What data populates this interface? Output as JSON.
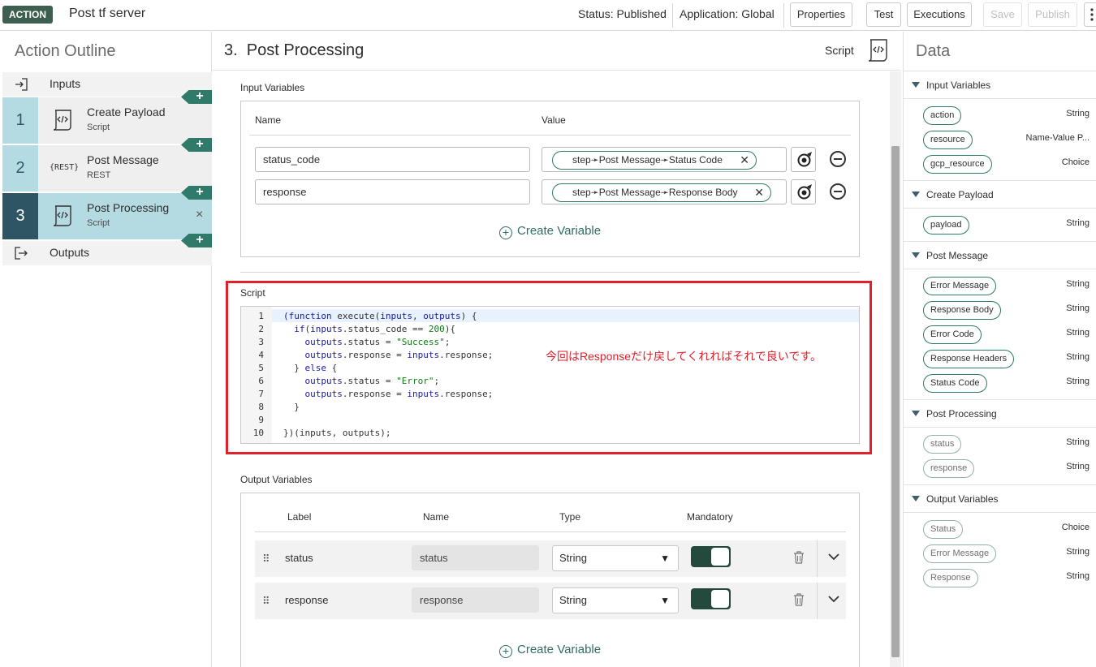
{
  "header": {
    "badge": "ACTION",
    "title": "Post tf server",
    "status": "Status: Published",
    "application": "Application: Global",
    "buttons": {
      "properties": "Properties",
      "test": "Test",
      "executions": "Executions",
      "save": "Save",
      "publish": "Publish"
    }
  },
  "outline": {
    "title": "Action Outline",
    "inputs_label": "Inputs",
    "outputs_label": "Outputs",
    "plus": "+",
    "close": "×",
    "steps": [
      {
        "num": "1",
        "name": "Create Payload",
        "type": "Script",
        "icon": "script-icon"
      },
      {
        "num": "2",
        "name": "Post Message",
        "type": "REST",
        "icon": "rest-icon",
        "icon_text": "{REST}"
      },
      {
        "num": "3",
        "name": "Post Processing",
        "type": "Script",
        "icon": "script-icon"
      }
    ]
  },
  "main": {
    "title": "3.  Post Processing",
    "script_label": "Script",
    "input_variables": {
      "label": "Input Variables",
      "col_name": "Name",
      "col_value": "Value",
      "rows": [
        {
          "name": "status_code",
          "value": "step➛Post Message➛Status Code"
        },
        {
          "name": "response",
          "value": "step➛Post Message➛Response Body"
        }
      ],
      "create": "Create Variable"
    },
    "script": {
      "label": "Script",
      "annotation": "今回はResponseだけ戻してくれればそれで良いです。",
      "line_numbers": [
        "1",
        "2",
        "3",
        "4",
        "5",
        "6",
        "7",
        "8",
        "9",
        "10"
      ]
    },
    "output_variables": {
      "label": "Output Variables",
      "col_label": "Label",
      "col_name": "Name",
      "col_type": "Type",
      "col_mandatory": "Mandatory",
      "rows": [
        {
          "label": "status",
          "name": "status",
          "type": "String",
          "mandatory": true
        },
        {
          "label": "response",
          "name": "response",
          "type": "String",
          "mandatory": true
        }
      ],
      "create": "Create Variable"
    }
  },
  "data_panel": {
    "title": "Data",
    "sections": [
      {
        "label": "Input Variables",
        "items": [
          {
            "name": "action",
            "type": "String"
          },
          {
            "name": "resource",
            "type": "Name-Value P..."
          },
          {
            "name": "gcp_resource",
            "type": "Choice"
          }
        ]
      },
      {
        "label": "Create Payload",
        "items": [
          {
            "name": "payload",
            "type": "String"
          }
        ]
      },
      {
        "label": "Post Message",
        "items": [
          {
            "name": "Error Message",
            "type": "String"
          },
          {
            "name": "Response Body",
            "type": "String"
          },
          {
            "name": "Error Code",
            "type": "String"
          },
          {
            "name": "Response Headers",
            "type": "String"
          },
          {
            "name": "Status Code",
            "type": "String"
          }
        ]
      },
      {
        "label": "Post Processing",
        "items": [
          {
            "name": "status",
            "type": "String"
          },
          {
            "name": "response",
            "type": "String"
          }
        ]
      },
      {
        "label": "Output Variables",
        "items": [
          {
            "name": "Status",
            "type": "Choice"
          },
          {
            "name": "Error Message",
            "type": "String"
          },
          {
            "name": "Response",
            "type": "String"
          }
        ]
      }
    ]
  },
  "colors": {
    "accent": "#2f7a68",
    "active_step": "#2d5563",
    "step_light": "#b5dbe2",
    "annotation": "#e0202a",
    "badge": "#3c5f4f"
  }
}
